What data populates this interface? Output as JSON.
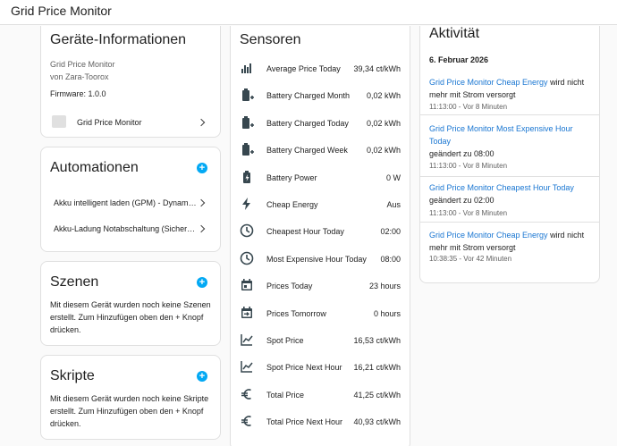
{
  "app": {
    "title": "Grid Price Monitor"
  },
  "device_info": {
    "title": "Geräte-Informationen",
    "model": "Grid Price Monitor",
    "manufacturer": "von Zara-Toorox",
    "firmware": "Firmware: 1.0.0",
    "device_link": "Grid Price Monitor"
  },
  "automations": {
    "title": "Automationen",
    "items": [
      {
        "label": "Akku intelligent laden (GPM) - Dynamis…"
      },
      {
        "label": "Akku-Ladung Notabschaltung (Sicherh…"
      }
    ]
  },
  "scenes": {
    "title": "Szenen",
    "text": "Mit diesem Gerät wurden noch keine Szenen erstellt. Zum Hinzufügen oben den + Knopf drücken."
  },
  "scripts": {
    "title": "Skripte",
    "text": "Mit diesem Gerät wurden noch keine Skripte erstellt. Zum Hinzufügen oben den + Knopf drücken."
  },
  "sensors": {
    "title": "Sensoren",
    "items": [
      {
        "name": "Average Price Today",
        "value": "39,34 ct/kWh",
        "icon": "bar-chart-icon"
      },
      {
        "name": "Battery Charged Month",
        "value": "0,02 kWh",
        "icon": "battery-plus-icon"
      },
      {
        "name": "Battery Charged Today",
        "value": "0,02 kWh",
        "icon": "battery-plus-icon"
      },
      {
        "name": "Battery Charged Week",
        "value": "0,02 kWh",
        "icon": "battery-plus-icon"
      },
      {
        "name": "Battery Power",
        "value": "0 W",
        "icon": "battery-charging-icon"
      },
      {
        "name": "Cheap Energy",
        "value": "Aus",
        "icon": "lightning-icon"
      },
      {
        "name": "Cheapest Hour Today",
        "value": "02:00",
        "icon": "clock-icon"
      },
      {
        "name": "Most Expensive Hour Today",
        "value": "08:00",
        "icon": "clock-icon"
      },
      {
        "name": "Prices Today",
        "value": "23 hours",
        "icon": "calendar-icon"
      },
      {
        "name": "Prices Tomorrow",
        "value": "0 hours",
        "icon": "calendar-arrow-icon"
      },
      {
        "name": "Spot Price",
        "value": "16,53 ct/kWh",
        "icon": "line-chart-icon"
      },
      {
        "name": "Spot Price Next Hour",
        "value": "16,21 ct/kWh",
        "icon": "line-chart-icon"
      },
      {
        "name": "Total Price",
        "value": "41,25 ct/kWh",
        "icon": "euro-icon"
      },
      {
        "name": "Total Price Next Hour",
        "value": "40,93 ct/kWh",
        "icon": "euro-icon"
      }
    ]
  },
  "activity": {
    "title": "Aktivität",
    "date": "6. Februar 2026",
    "entries": [
      {
        "link": "Grid Price Monitor Cheap Energy",
        "rest": " wird nicht mehr mit Strom versorgt",
        "time": "11:13:00 - Vor 8 Minuten"
      },
      {
        "link": "Grid Price Monitor Most Expensive Hour Today",
        "rest": "geändert zu 08:00",
        "time": "11:13:00 - Vor 8 Minuten"
      },
      {
        "link": "Grid Price Monitor Cheapest Hour Today",
        "rest": "geändert zu 02:00",
        "time": "11:13:00 - Vor 8 Minuten"
      },
      {
        "link": "Grid Price Monitor Cheap Energy",
        "rest": " wird nicht mehr mit Strom versorgt",
        "time": "10:38:35 - Vor 42 Minuten"
      }
    ]
  },
  "colors": {
    "accent": "#03a9f4",
    "icon": "#37474f",
    "link": "#1976d2"
  }
}
